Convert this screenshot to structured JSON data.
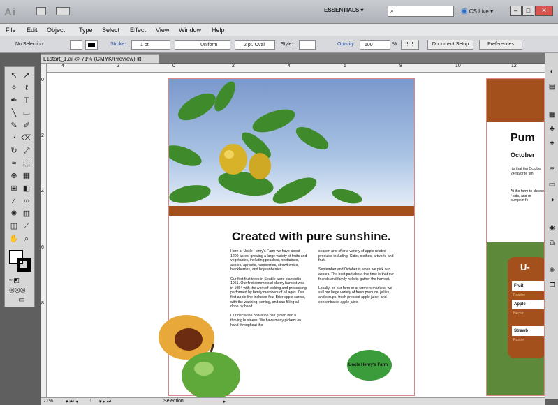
{
  "app": {
    "logo": "Ai",
    "workspace": "ESSENTIALS",
    "cslive": "CS Live",
    "min": "–",
    "max": "□",
    "close": "✕"
  },
  "menu": [
    "File",
    "Edit",
    "Object",
    "Type",
    "Select",
    "Effect",
    "View",
    "Window",
    "Help"
  ],
  "control": {
    "selection": "No Selection",
    "stroke_label": "Stroke:",
    "stroke_value": "1 pt",
    "uniform": "Uniform",
    "brush": "2 pt. Oval",
    "style": "Style:",
    "opacity_label": "Opacity:",
    "opacity_value": "100",
    "percent": "%",
    "doc_setup": "Document Setup",
    "preferences": "Preferences"
  },
  "tab": {
    "title": "L1start_1.ai @ 71% (CMYK/Preview)",
    "close": "⊠"
  },
  "ruler": {
    "h": [
      "4",
      "2",
      "0",
      "2",
      "4",
      "6",
      "8",
      "10",
      "12"
    ],
    "v": [
      "0",
      "2",
      "4",
      "6",
      "8"
    ]
  },
  "page1": {
    "headline": "Created with pure sunshine.",
    "col1": [
      "Here at Uncle Henry's Farm we have about 1200 acres, growing a large variety of fruits and vegetables, including peaches, nectarines, apples, apricots, raspberries, strawberries, blackberries, and boysenberries.",
      "Our first fruit trees in Seattle were planted in 1951. Our first commercial cherry harvest was in 1954 with the work of picking and processing performed by family members of all ages. Our first apple line included four Brier apple carers, with the washing, sorting, and can filling all done by hand.",
      "Our nectarine operation has grown into a thriving business. We have many pickers on hand throughout the"
    ],
    "col2": [
      "season and offer a variety of apple related products including: Cider, clothes, artwork, and fruit.",
      "September and October is when we pick our apples. The best part about this time is that our friends and family help to gather the harvest.",
      "Locally, on our farm or at farmers markets, we sell our large variety of fresh produce, jellies, and syrups, fresh pressed apple juice, and concentrated apple juice."
    ],
    "logo": "Uncle Henry's Farm"
  },
  "page2": {
    "title": "Pum",
    "subtitle": "October",
    "t1": "It's that tim October 24 favorite tim",
    "t2": "At the farm to choose f kids, and m pumpkin fe",
    "badge": "U-",
    "rows": [
      "Fruit",
      "Apple",
      "Strawb"
    ],
    "small": [
      "Peache",
      "Nectar",
      "Rasber"
    ]
  },
  "status": {
    "zoom": "71%",
    "page": "1",
    "tool": "Selection"
  },
  "colors": {
    "accent": "#a3501c",
    "green": "#5c8a3a"
  }
}
